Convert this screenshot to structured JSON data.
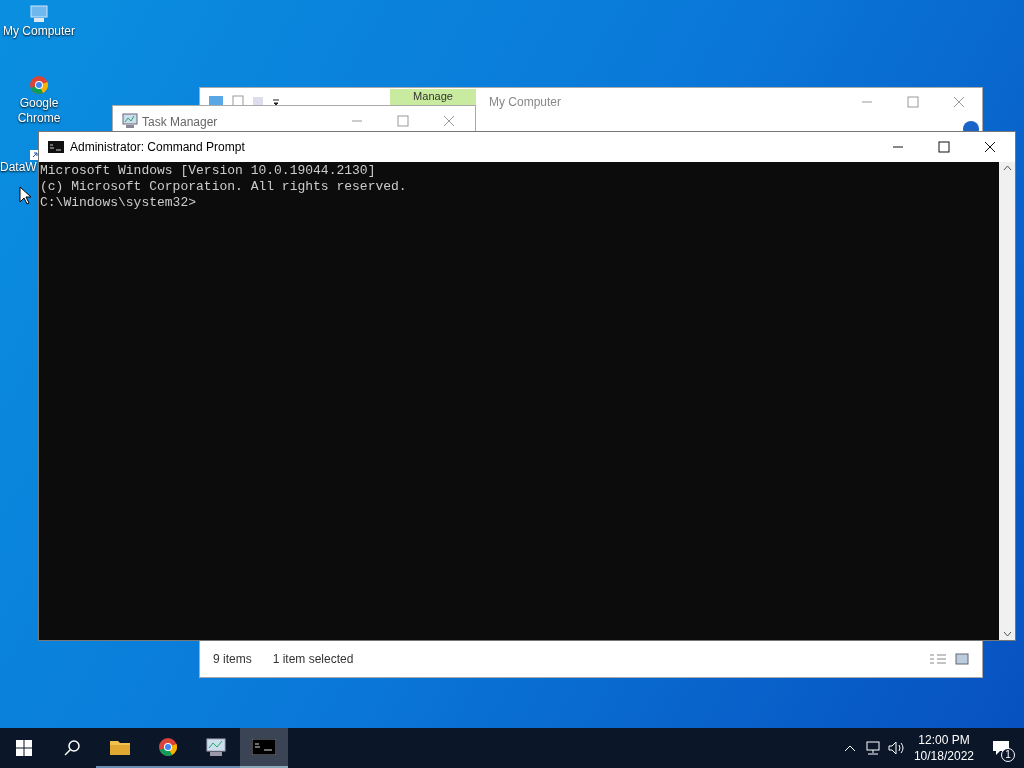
{
  "desktop_icons": [
    {
      "kind": "computer",
      "label": "My Computer"
    },
    {
      "kind": "chrome",
      "label": "Google Chrome"
    },
    {
      "kind": "shortcut",
      "label": "DataW"
    }
  ],
  "explorer": {
    "title": "My Computer",
    "ribbon_tab": "Manage",
    "status_items": "9 items",
    "status_selection": "1 item selected"
  },
  "task_manager": {
    "title": "Task Manager"
  },
  "command_prompt": {
    "title": "Administrator: Command Prompt",
    "lines": [
      "Microsoft Windows [Version 10.0.19044.2130]",
      "(c) Microsoft Corporation. All rights reserved.",
      "C:\\Windows\\system32>"
    ]
  },
  "taskbar": {
    "apps": [
      {
        "kind": "explorer",
        "selected": false
      },
      {
        "kind": "chrome",
        "selected": false
      },
      {
        "kind": "taskmgr",
        "selected": false
      },
      {
        "kind": "cmd",
        "selected": true
      }
    ],
    "time": "12:00 PM",
    "date": "10/18/2022",
    "notifications": "1"
  }
}
